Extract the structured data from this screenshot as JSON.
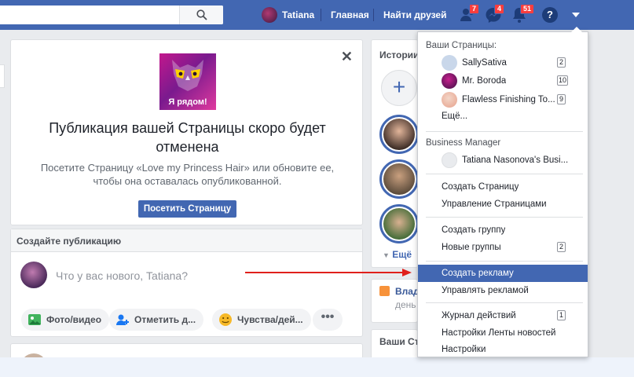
{
  "topbar": {
    "user_name": "Tatiana",
    "nav_home": "Главная",
    "nav_find_friends": "Найти друзей",
    "badge_friends": "7",
    "badge_messages": "4",
    "badge_notifications": "51",
    "help": "?",
    "accent": "#4267b2"
  },
  "notice": {
    "image_caption": "Я рядом!",
    "title": "Публикация вашей Страницы скоро будет отменена",
    "text": "Посетите Страницу «Love my Princess Hair» или обновите ее, чтобы она оставалась опубликованной.",
    "button": "Посетить Страницу",
    "close": "✕"
  },
  "composer": {
    "header": "Создайте публикацию",
    "placeholder": "Что у вас нового, Tatiana?",
    "actions": [
      "Фото/видео",
      "Отметить д...",
      "Чувства/дей..."
    ],
    "more": "•••"
  },
  "stories": {
    "title": "Истории",
    "add": "+",
    "more": "Ещё"
  },
  "birthday": {
    "name": "Влад",
    "sub": "день"
  },
  "friends_box": {
    "title": "Ваши Ст"
  },
  "dropdown": {
    "pages_header": "Ваши Страницы:",
    "pages": [
      {
        "name": "SallySativa",
        "count": "2"
      },
      {
        "name": "Mr. Boroda",
        "count": "10"
      },
      {
        "name": "Flawless Finishing To...",
        "count": "9"
      }
    ],
    "more": "Ещё...",
    "bm_header": "Business Manager",
    "bm_account": "Tatiana Nasonova's Busi...",
    "create_page": "Создать Страницу",
    "manage_pages": "Управление Страницами",
    "create_group": "Создать группу",
    "new_groups": "Новые группы",
    "new_groups_count": "2",
    "create_ad": "Создать рекламу",
    "manage_ads": "Управлять рекламой",
    "activity_log": "Журнал действий",
    "activity_log_count": "1",
    "news_feed_prefs": "Настройки Ленты новостей",
    "settings": "Настройки"
  },
  "annotation": {
    "arrow_color": "#e0201b"
  }
}
